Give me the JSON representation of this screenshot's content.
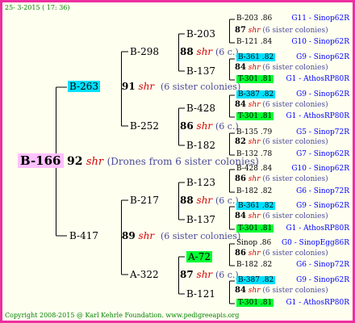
{
  "header": "25-  3-2015  ( 17: 36)",
  "footer": "Copyright 2008-2015 @ Karl Kehrle Foundation.   www.pedigreeapis.org",
  "root": {
    "label": "B-166",
    "num": "92",
    "shr": "shr",
    "note": "(Drones from 6 sister colonies)"
  },
  "gen1": [
    {
      "label": "B-263",
      "num": "91",
      "shr": "shr",
      "note": "(6 sister colonies)"
    },
    {
      "label": "B-417",
      "num": "89",
      "shr": "shr",
      "note": "(6 sister colonies)"
    }
  ],
  "gen2": [
    {
      "label": "B-298",
      "num": "88",
      "shr": "shr",
      "note": "(6 c.)"
    },
    {
      "label": "B-252",
      "num": "86",
      "shr": "shr",
      "note": "(6 c.)"
    },
    {
      "label": "B-217",
      "num": "88",
      "shr": "shr",
      "note": "(6 c.)"
    },
    {
      "label": "A-322",
      "num": "87",
      "shr": "shr",
      "note": "(6 c.)"
    }
  ],
  "gen3": [
    {
      "label": "B-203",
      "num": "87",
      "shr": "shr",
      "note": "(6 sister colonies)"
    },
    {
      "label": "B-137",
      "num": "84",
      "shr": "shr",
      "note": "(6 sister colonies)"
    },
    {
      "label": "B-428",
      "num": "84",
      "shr": "shr",
      "note": "(6 sister colonies)"
    },
    {
      "label": "B-182",
      "num": "82",
      "shr": "shr",
      "note": "(6 sister colonies)"
    },
    {
      "label": "B-123",
      "num": "86",
      "shr": "shr",
      "note": "(6 sister colonies)"
    },
    {
      "label": "B-137",
      "num": "84",
      "shr": "shr",
      "note": "(6 sister colonies)"
    },
    {
      "label": "A-72",
      "num": "86",
      "shr": "shr",
      "note": "(6 sister colonies)"
    },
    {
      "label": "B-121",
      "num": "84",
      "shr": "shr",
      "note": "(6 sister colonies)"
    }
  ],
  "gen4": [
    {
      "label": "B-203",
      "val": ".86",
      "lineage": "G11 - Sinop62R"
    },
    {
      "label": "B-121",
      "val": ".84",
      "lineage": "G10 - Sinop62R"
    },
    {
      "label": "B-361",
      "val": ".82",
      "lineage": "G9 - Sinop62R"
    },
    {
      "label": "T-301",
      "val": ".81",
      "lineage": "G1 - AthosRP80R"
    },
    {
      "label": "B-387",
      "val": ".82",
      "lineage": "G9 - Sinop62R"
    },
    {
      "label": "T-301",
      "val": ".81",
      "lineage": "G1 - AthosRP80R"
    },
    {
      "label": "B-135",
      "val": ".79",
      "lineage": "G5 - Sinop72R"
    },
    {
      "label": "B-132",
      "val": ".78",
      "lineage": "G7 - Sinop62R"
    },
    {
      "label": "B-428",
      "val": ".84",
      "lineage": "G10 - Sinop62R"
    },
    {
      "label": "B-182",
      "val": ".82",
      "lineage": "G6 - Sinop72R"
    },
    {
      "label": "B-361",
      "val": ".82",
      "lineage": "G9 - Sinop62R"
    },
    {
      "label": "T-301",
      "val": ".81",
      "lineage": "G1 - AthosRP80R"
    },
    {
      "label": "Sinop",
      "val": ".86",
      "lineage": "G0 - SinopEgg86R"
    },
    {
      "label": "B-182",
      "val": ".82",
      "lineage": "G6 - Sinop72R"
    },
    {
      "label": "B-387",
      "val": ".82",
      "lineage": "G9 - Sinop62R"
    },
    {
      "label": "T-301",
      "val": ".81",
      "lineage": "G1 - AthosRP80R"
    }
  ],
  "colors": {
    "border": "#ee2ea0",
    "background": "#fffff0",
    "blue_box": "#00e0ff",
    "green_box": "#00ff33",
    "pink_box": "#ffc0ff",
    "shr": "#d40000"
  }
}
